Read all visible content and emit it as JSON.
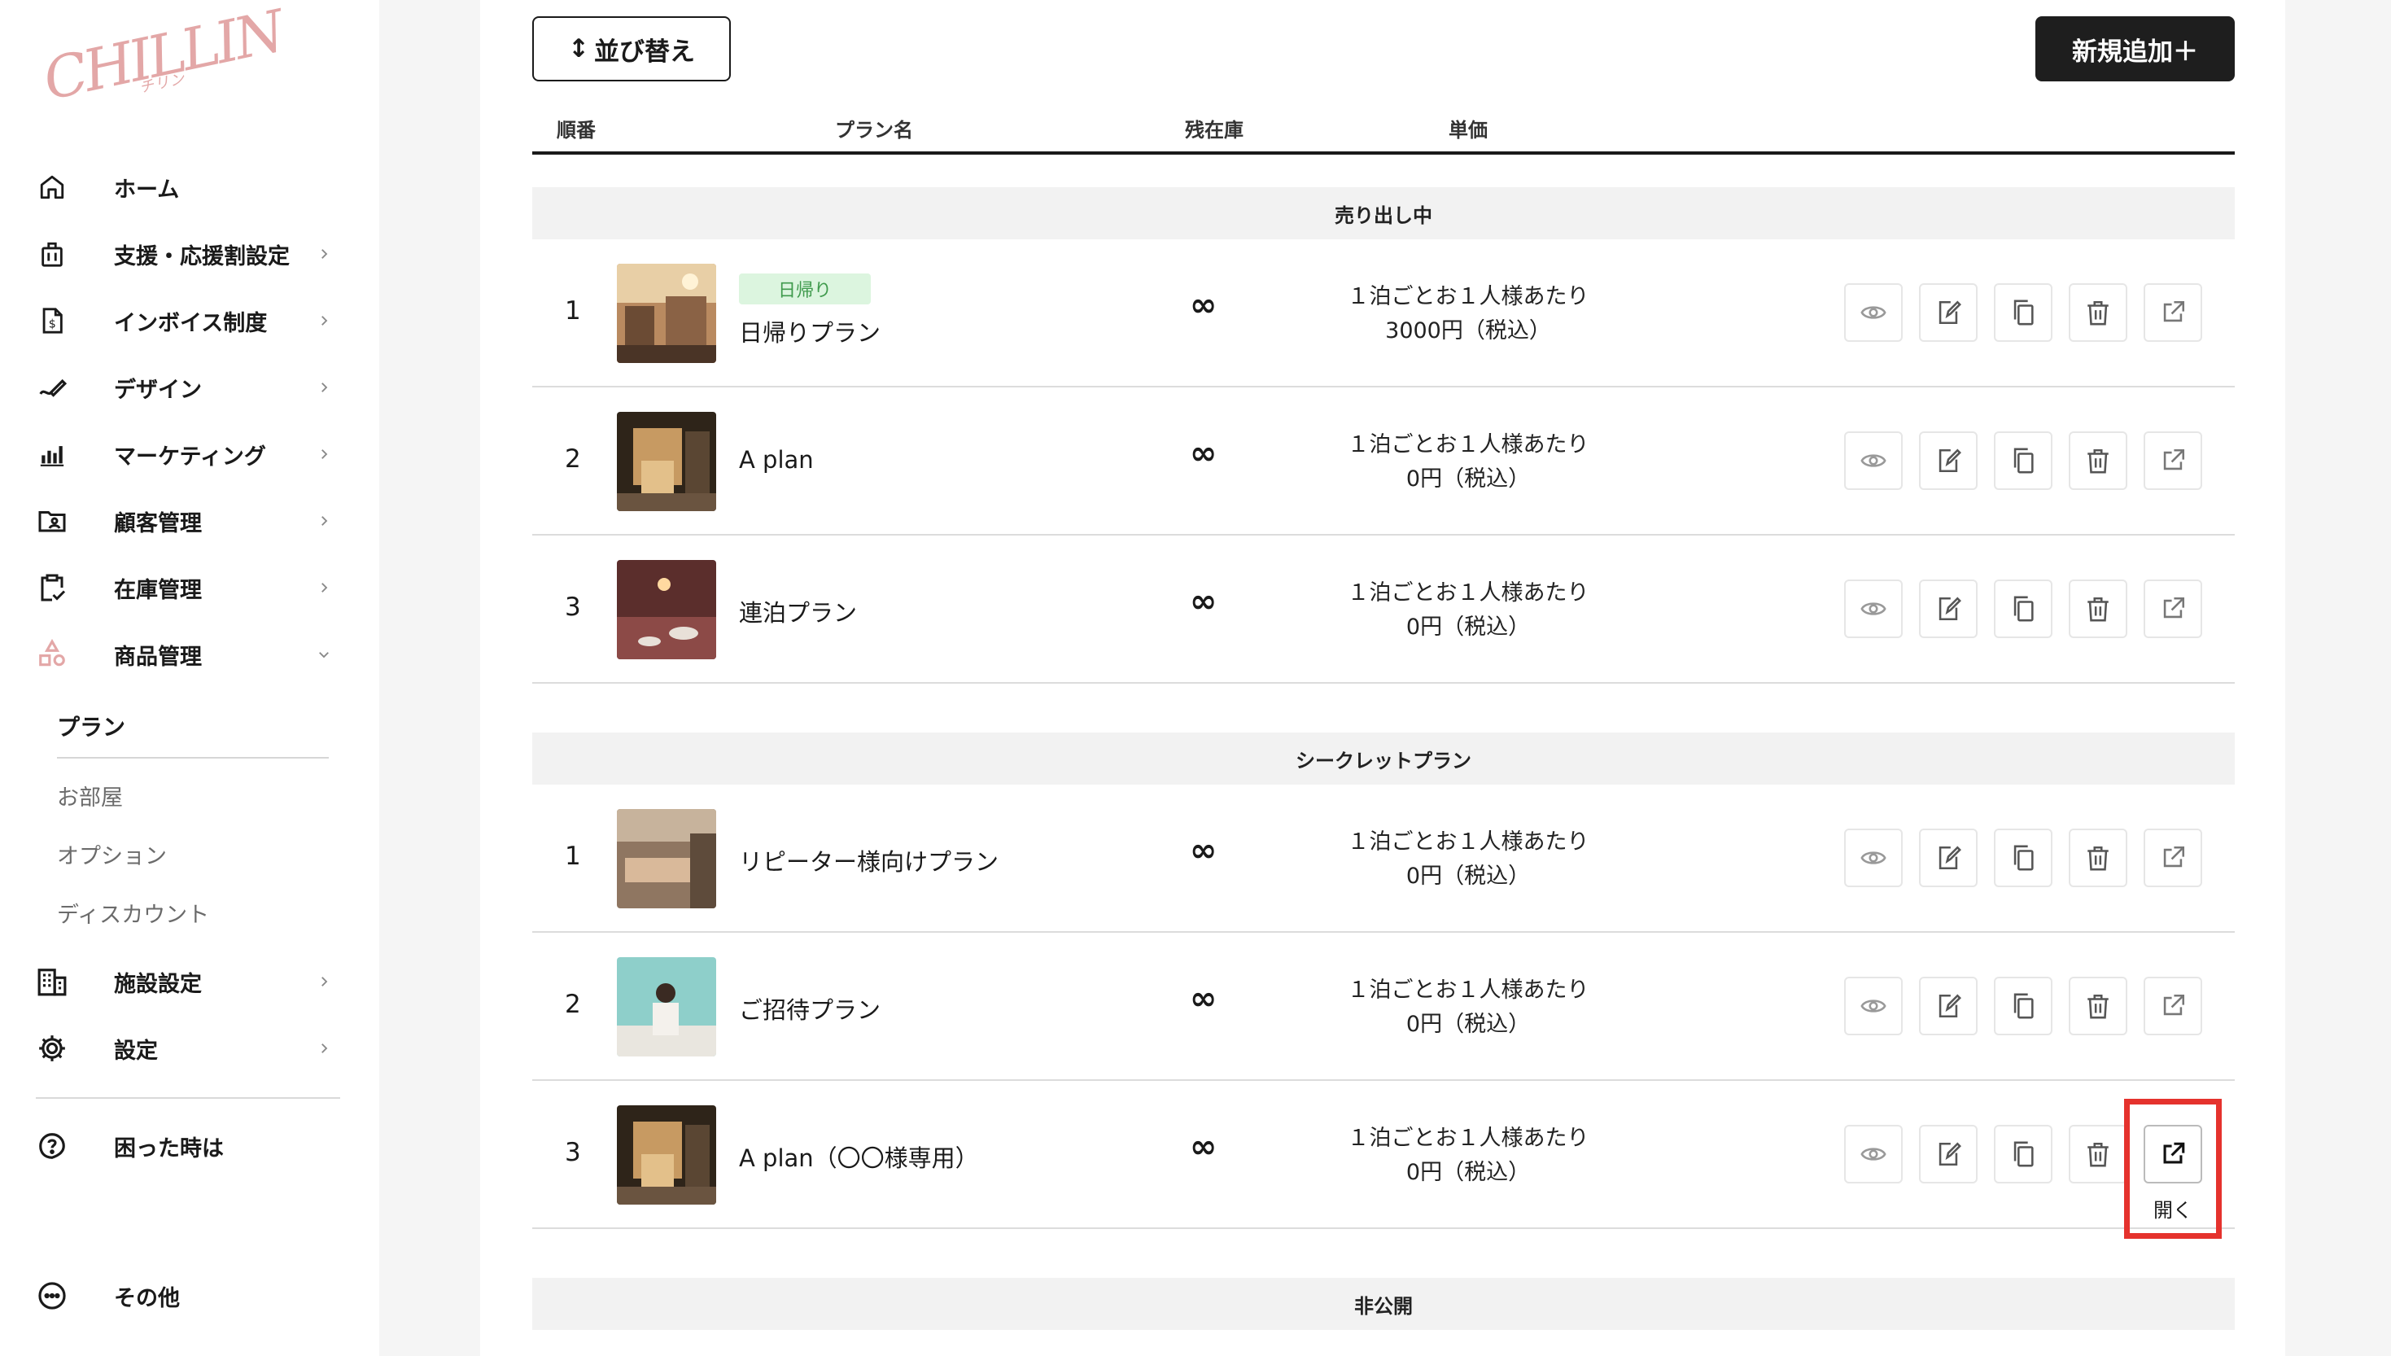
{
  "brand": {
    "logo_text": "CHILLIN",
    "logo_sub": "チリン"
  },
  "sidebar": {
    "items": [
      {
        "label": "ホーム",
        "icon": "home-icon"
      },
      {
        "label": "支援・応援割設定",
        "icon": "bag-icon"
      },
      {
        "label": "インボイス制度",
        "icon": "invoice-icon"
      },
      {
        "label": "デザイン",
        "icon": "pen-icon"
      },
      {
        "label": "マーケティング",
        "icon": "bar-chart-icon"
      },
      {
        "label": "顧客管理",
        "icon": "folder-user-icon"
      },
      {
        "label": "在庫管理",
        "icon": "clipboard-check-icon"
      },
      {
        "label": "商品管理",
        "icon": "shapes-icon"
      }
    ],
    "product_sub": {
      "title": "プラン",
      "items": [
        "お部屋",
        "オプション",
        "ディスカウント"
      ]
    },
    "items2": [
      {
        "label": "施設設定",
        "icon": "building-icon"
      },
      {
        "label": "設定",
        "icon": "gear-icon"
      }
    ],
    "help": "困った時は",
    "other": "その他"
  },
  "toolbar": {
    "sort_label": "並び替え",
    "add_label": "新規追加＋"
  },
  "table": {
    "headers": {
      "order": "順番",
      "name": "プラン名",
      "stock": "残在庫",
      "price": "単価"
    }
  },
  "sections": [
    {
      "title": "売り出し中",
      "rows": [
        {
          "num": "1",
          "badge": "日帰り",
          "name": "日帰りプラン",
          "stock": "∞",
          "price_line1": "１泊ごとお１人様あたり",
          "price_line2": "3000円（税込）"
        },
        {
          "num": "2",
          "name": "A plan",
          "stock": "∞",
          "price_line1": "１泊ごとお１人様あたり",
          "price_line2": "0円（税込）"
        },
        {
          "num": "3",
          "name": "連泊プラン",
          "stock": "∞",
          "price_line1": "１泊ごとお１人様あたり",
          "price_line2": "0円（税込）"
        }
      ]
    },
    {
      "title": "シークレットプラン",
      "rows": [
        {
          "num": "1",
          "name": "リピーター様向けプラン",
          "stock": "∞",
          "price_line1": "１泊ごとお１人様あたり",
          "price_line2": "0円（税込）"
        },
        {
          "num": "2",
          "name": "ご招待プラン",
          "stock": "∞",
          "price_line1": "１泊ごとお１人様あたり",
          "price_line2": "0円（税込）"
        },
        {
          "num": "3",
          "name": "A plan（〇〇様専用）",
          "stock": "∞",
          "price_line1": "１泊ごとお１人様あたり",
          "price_line2": "0円（税込）"
        }
      ]
    },
    {
      "title": "非公開",
      "rows": []
    }
  ],
  "actions": {
    "open_label": "開く"
  },
  "colors": {
    "accent_dark": "#1e1e1e",
    "highlight": "#e5322d",
    "badge_bg": "#dcf5df",
    "badge_text": "#3f9a4c"
  }
}
